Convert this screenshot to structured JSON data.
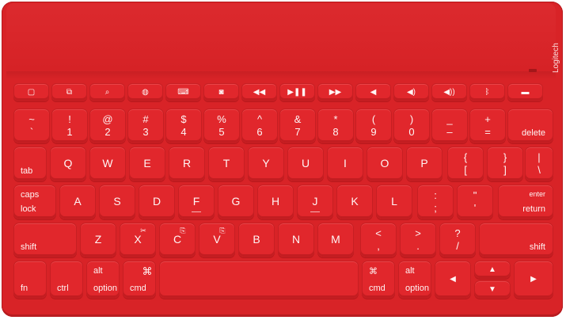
{
  "brand": {
    "logo_text": "Logitech"
  },
  "function_row": [
    {
      "name": "home-icon",
      "glyph": "▢"
    },
    {
      "name": "switch-app-icon",
      "glyph": "⧉"
    },
    {
      "name": "search-icon",
      "glyph": "⌕"
    },
    {
      "name": "globe-icon",
      "glyph": "◍"
    },
    {
      "name": "keyboard-icon",
      "glyph": "⌨"
    },
    {
      "name": "camera-icon",
      "glyph": "◙"
    },
    {
      "name": "rewind-icon",
      "glyph": "◀◀"
    },
    {
      "name": "play-pause-icon",
      "glyph": "▶❚❚"
    },
    {
      "name": "fast-forward-icon",
      "glyph": "▶▶"
    },
    {
      "name": "mute-icon",
      "glyph": "◀"
    },
    {
      "name": "volume-down-icon",
      "glyph": "◀)"
    },
    {
      "name": "volume-up-icon",
      "glyph": "◀))"
    },
    {
      "name": "bluetooth-icon",
      "glyph": "ᛒ"
    },
    {
      "name": "battery-icon",
      "glyph": "▬"
    }
  ],
  "row1": [
    {
      "top": "~",
      "bottom": "`"
    },
    {
      "top": "!",
      "bottom": "1"
    },
    {
      "top": "@",
      "bottom": "2"
    },
    {
      "top": "#",
      "bottom": "3"
    },
    {
      "top": "$",
      "bottom": "4"
    },
    {
      "top": "%",
      "bottom": "5"
    },
    {
      "top": "^",
      "bottom": "6"
    },
    {
      "top": "&",
      "bottom": "7"
    },
    {
      "top": "*",
      "bottom": "8"
    },
    {
      "top": "(",
      "bottom": "9"
    },
    {
      "top": ")",
      "bottom": "0"
    },
    {
      "top": "_",
      "bottom": "–"
    },
    {
      "top": "+",
      "bottom": "="
    }
  ],
  "delete_label": "delete",
  "tab_label": "tab",
  "row2": [
    "Q",
    "W",
    "E",
    "R",
    "T",
    "Y",
    "U",
    "I",
    "O",
    "P"
  ],
  "row2_sym": [
    {
      "top": "{",
      "bottom": "["
    },
    {
      "top": "}",
      "bottom": "]"
    },
    {
      "top": "|",
      "bottom": "\\"
    }
  ],
  "caps_label_1": "caps",
  "caps_label_2": "lock",
  "row3": [
    "A",
    "S",
    "D",
    "F",
    "G",
    "H",
    "J",
    "K",
    "L"
  ],
  "row3_sym": [
    {
      "top": ":",
      "bottom": ";"
    },
    {
      "top": "\"",
      "bottom": "'"
    }
  ],
  "enter_label": "enter",
  "return_label": "return",
  "shift_label": "shift",
  "row4": [
    "Z",
    "X",
    "C",
    "V",
    "B",
    "N",
    "M"
  ],
  "row4_sub": {
    "X": "✂",
    "C": "⎘",
    "V": "⎘"
  },
  "row4_sym": [
    {
      "top": "<",
      "bottom": ","
    },
    {
      "top": ">",
      "bottom": "."
    },
    {
      "top": "?",
      "bottom": "/"
    }
  ],
  "fn_label": "fn",
  "ctrl_label": "ctrl",
  "alt_label": "alt",
  "option_label": "option",
  "cmd_symbol": "⌘",
  "cmd_label": "cmd",
  "arrows": {
    "left": "◀",
    "up": "▲",
    "down": "▼",
    "right": "▶"
  }
}
